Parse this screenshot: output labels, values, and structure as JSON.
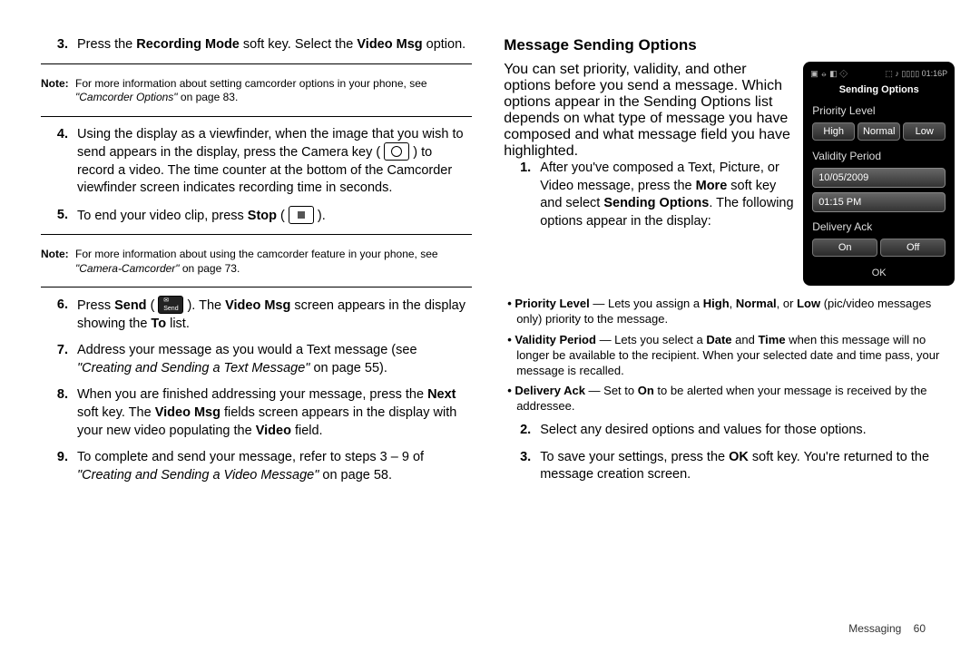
{
  "left": {
    "step3": {
      "num": "3.",
      "t1": "Press the ",
      "t2": "Recording Mode",
      "t3": " soft key. Select the ",
      "t4": "Video Msg",
      "t5": " option."
    },
    "note1": {
      "label": "Note:",
      "text_a": "For more information about setting camcorder options in your phone, see ",
      "text_i": "\"Camcorder Options\"",
      "text_b": " on page 83."
    },
    "step4": {
      "num": "4.",
      "text": "Using the display as a viewfinder, when the image that you wish to send appears in the display, press the Camera key ( ",
      "text2": " ) to record a video. The time counter at the bottom of the Camcorder viewfinder screen indicates recording time in seconds."
    },
    "step5": {
      "num": "5.",
      "t1": "To end your video clip, press ",
      "t2": "Stop",
      "t3": " ( ",
      "t4": " )."
    },
    "note2": {
      "label": "Note:",
      "text_a": "For more information about using the camcorder feature in your phone, see ",
      "text_i": "\"Camera-Camcorder\"",
      "text_b": " on page 73."
    },
    "step6": {
      "num": "6.",
      "t1": "Press ",
      "t2": "Send",
      "t3": " ( ",
      "t4": " ). The ",
      "t5": "Video Msg",
      "t6": " screen appears in the display showing the ",
      "t7": "To",
      "t8": " list."
    },
    "step7": {
      "num": "7.",
      "t1": "Address your message as you would a Text message (see ",
      "t2": "\"Creating and Sending a Text Message\"",
      "t3": " on page 55)."
    },
    "step8": {
      "num": "8.",
      "t1": "When you are finished addressing your message, press the ",
      "t2": "Next",
      "t3": " soft key. The ",
      "t4": "Video Msg",
      "t5": " fields screen appears in the display with your new video populating the ",
      "t6": "Video",
      "t7": " field."
    },
    "step9": {
      "num": "9.",
      "t1": "To complete and send your message, refer to steps 3 – 9 of ",
      "t2": "\"Creating and Sending a Video Message\"",
      "t3": " on page 58."
    }
  },
  "right": {
    "heading": "Message Sending Options",
    "intro": "You can set priority, validity, and other options before you send a message. Which options appear in the Sending Options list depends on what type of message you have composed and what message field you have highlighted.",
    "step1": {
      "num": "1.",
      "t1": "After you've composed a Text, Picture, or Video message, press the ",
      "t2": "More",
      "t3": " soft key and select ",
      "t4": "Sending Options",
      "t5": ". The following options appear in the display:"
    },
    "b_priority": {
      "name": "Priority Level",
      "dash": " — Lets you assign a ",
      "h": "High",
      "n": "Normal",
      "l": "Low",
      "rest": " (pic/video messages only) priority to the message."
    },
    "b_validity": {
      "name": "Validity Period",
      "dash": " — Lets you select a ",
      "d": "Date",
      "and": " and ",
      "t": "Time",
      "rest": " when this message will no longer be available to the recipient. When your selected date and time pass, your message is recalled."
    },
    "b_delivery": {
      "name": "Delivery Ack",
      "dash": " — Set to ",
      "on": "On",
      "rest": " to be alerted when your message is received by the addressee."
    },
    "step2": {
      "num": "2.",
      "text": "Select any desired options and values for those options."
    },
    "step3": {
      "num": "3.",
      "t1": "To save your settings, press the ",
      "t2": "OK",
      "t3": " soft key. You're returned to the message creation screen."
    }
  },
  "phone": {
    "status_left": "▣ ⦵ ◧ ⟐",
    "status_right": "⬚ ♪ ▯▯▯▯ 01:16P",
    "title": "Sending Options",
    "priority_label": "Priority Level",
    "priority": [
      "High",
      "Normal",
      "Low"
    ],
    "validity_label": "Validity Period",
    "date": "10/05/2009",
    "time": "01:15 PM",
    "delivery_label": "Delivery Ack",
    "delivery": [
      "On",
      "Off"
    ],
    "ok": "OK"
  },
  "footer": {
    "section": "Messaging",
    "page": "60"
  }
}
